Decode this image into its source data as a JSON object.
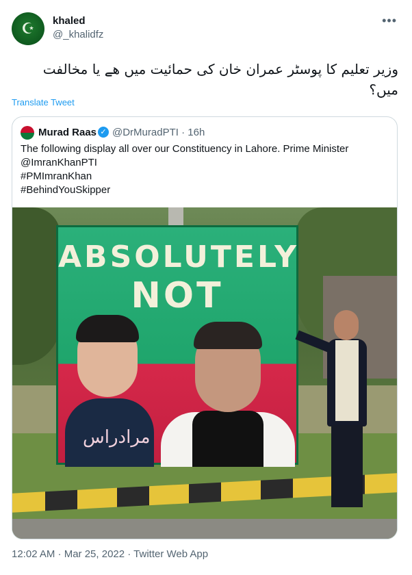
{
  "author": {
    "name": "khaled",
    "handle": "@_khalidfz",
    "avatar_icon": "crescent-star-icon"
  },
  "tweet": {
    "text": "وزیر تعلیم کا پوسٹر عمران خان کی حمائیت میں هے یا مخالفت میں؟",
    "translate_label": "Translate Tweet",
    "more_label": "•••"
  },
  "quoted": {
    "name": "Murad Raas",
    "handle": "@DrMuradPTI",
    "time": "16h",
    "separator": "·",
    "text_lines": [
      "The following display all over our Constituency in Lahore. Prime Minister",
      "@ImranKhanPTI",
      "#PMImranKhan",
      "#BehindYouSkipper"
    ],
    "photo": {
      "billboard_line1": "ABSOLUTELY",
      "billboard_line2": "NOT",
      "urdu_name": "مرادراس"
    }
  },
  "footer": {
    "timestamp": "12:02 AM · Mar 25, 2022 · Twitter Web App"
  },
  "colors": {
    "link": "#1d9bf0",
    "muted": "#536471",
    "text": "#0f1419"
  }
}
